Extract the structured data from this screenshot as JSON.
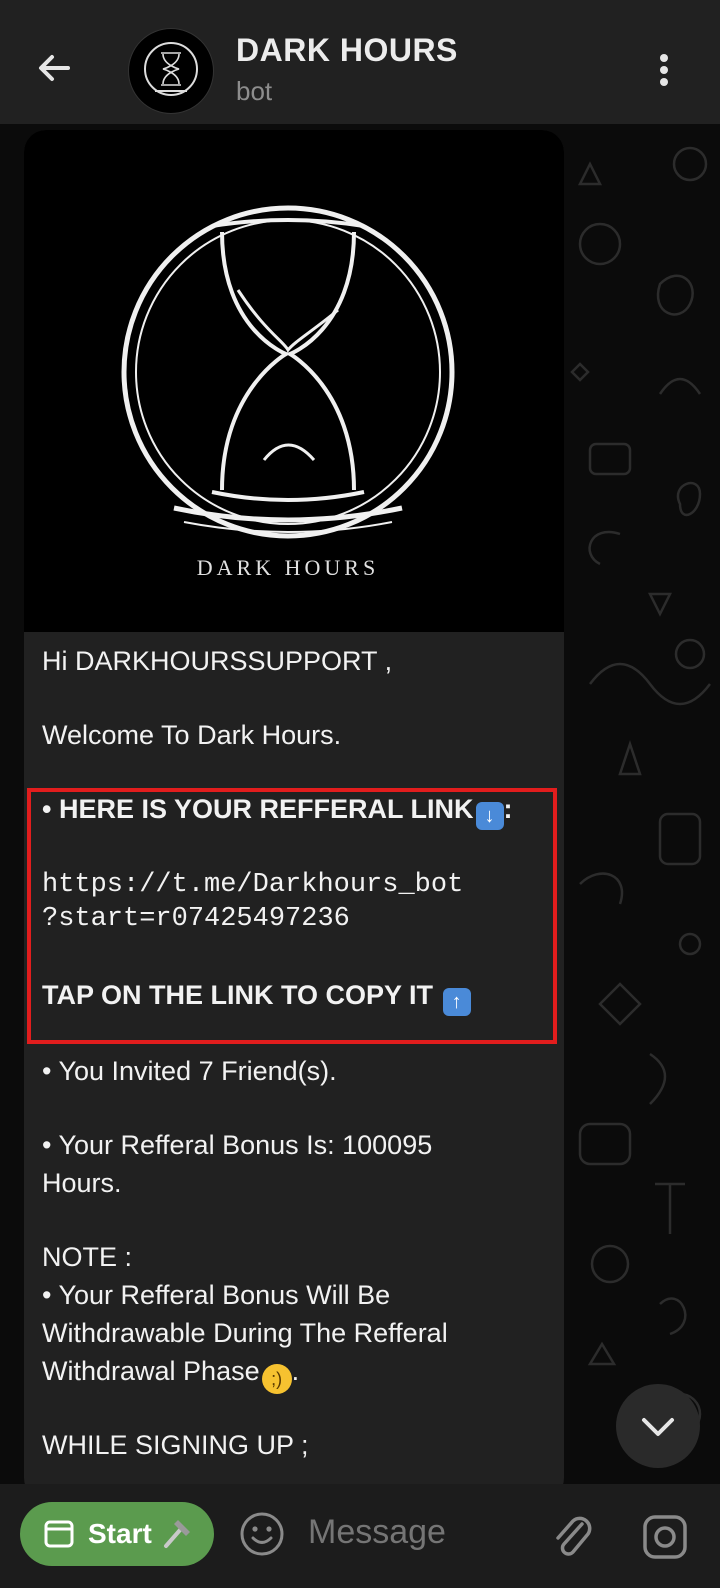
{
  "header": {
    "title": "DARK HOURS",
    "subtitle": "bot",
    "avatar_caption": "DARK HOURS"
  },
  "message": {
    "photo_caption": "DARK HOURS",
    "greeting": "Hi DARKHOURSSUPPORT ,",
    "welcome": "Welcome To Dark Hours.",
    "referral_heading": "• HERE IS YOUR REFFERAL LINK",
    "referral_heading_suffix": ":",
    "referral_emoji": "down-arrow-emoji",
    "link_line1": "https://t.me/Darkhours_bot",
    "link_line2": "?start=r07425497236",
    "copy_instruction": "TAP ON THE LINK TO COPY IT",
    "copy_emoji": "up-arrow-emoji",
    "invited": "• You Invited 7 Friend(s).",
    "bonus_line1": "• Your Refferal Bonus Is: 100095",
    "bonus_line2": "Hours.",
    "note_heading": "NOTE :",
    "note_line1": "• Your Refferal Bonus Will Be",
    "note_line2": "Withdrawable During The Refferal",
    "note_line3": "Withdrawal Phase",
    "note_end": ".",
    "note_emoji": "winking-face-emoji",
    "signing_up": "WHILE SIGNING UP ;"
  },
  "bottom_bar": {
    "start_label": "Start",
    "start_emoji": "hammer-icon",
    "message_placeholder": "Message"
  },
  "colors": {
    "header_bg": "#212121",
    "bubble_bg": "#212121",
    "highlight_border": "#e21d1d",
    "start_button": "#5b9b4e"
  }
}
